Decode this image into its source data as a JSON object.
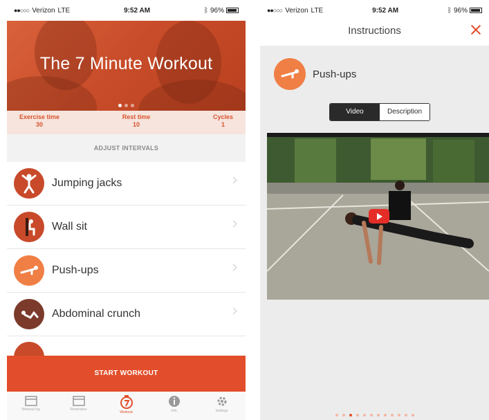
{
  "colors": {
    "accent": "#e24e2b",
    "icon_orange": "#f07f45",
    "icon_brown": "#7b3a2a"
  },
  "left": {
    "status": {
      "carrier": "Verizon",
      "network": "LTE",
      "time": "9:52 AM",
      "battery": "96%"
    },
    "hero": {
      "title": "The 7 Minute Workout",
      "page_count": 3,
      "active_page": 1
    },
    "stats": [
      {
        "label": "Exercise time",
        "value": "30"
      },
      {
        "label": "Rest time",
        "value": "10"
      },
      {
        "label": "Cycles",
        "value": "1"
      }
    ],
    "adjust_label": "ADJUST INTERVALS",
    "exercises": [
      {
        "label": "Jumping jacks",
        "icon": "jumping-jacks-icon",
        "color": "#c84a2a"
      },
      {
        "label": "Wall sit",
        "icon": "wall-sit-icon",
        "color": "#c84a2a"
      },
      {
        "label": "Push-ups",
        "icon": "push-ups-icon",
        "color": "#f07f45"
      },
      {
        "label": "Abdominal crunch",
        "icon": "abdominal-crunch-icon",
        "color": "#7b3a2a"
      }
    ],
    "start_label": "START WORKOUT",
    "tabs": [
      {
        "label": "Workout log",
        "icon": "calendar-icon"
      },
      {
        "label": "Reminders",
        "icon": "reminder-calendar-icon"
      },
      {
        "label": "Workout",
        "icon": "workout-7-icon",
        "active": true
      },
      {
        "label": "Info",
        "icon": "info-icon"
      },
      {
        "label": "Settings",
        "icon": "gear-icon"
      }
    ]
  },
  "right": {
    "status": {
      "carrier": "Verizon",
      "network": "LTE",
      "time": "9:52 AM",
      "battery": "96%"
    },
    "nav_title": "Instructions",
    "exercise": {
      "title": "Push-ups",
      "icon": "push-ups-icon"
    },
    "segments": [
      {
        "label": "Video",
        "selected": true
      },
      {
        "label": "Description",
        "selected": false
      }
    ],
    "pager": {
      "count": 12,
      "active": 2
    }
  }
}
